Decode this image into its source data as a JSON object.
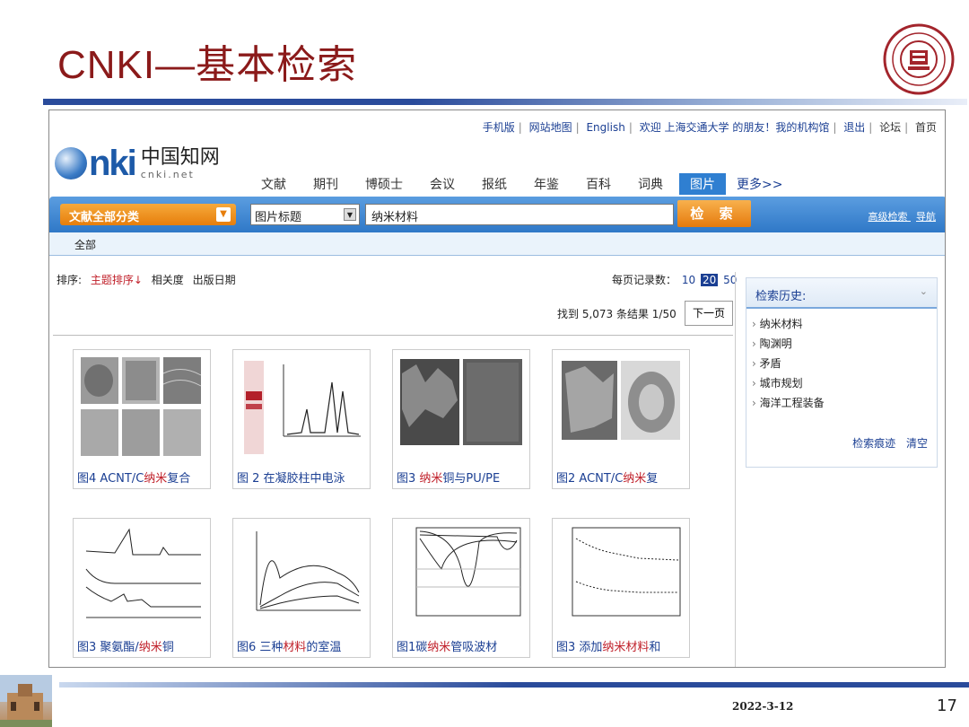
{
  "slide": {
    "title": "CNKI—基本检索",
    "date": "2022-3-12",
    "page_number": "17"
  },
  "toplinks": {
    "mobile": "手机版",
    "sitemap": "网站地图",
    "english": "English",
    "welcome": "欢迎 上海交通大学 的朋友！我的机构馆",
    "logout": "退出",
    "forum": "论坛",
    "home": "首页"
  },
  "logo": {
    "cn": "中国知网",
    "net": "cnki.net"
  },
  "nav": {
    "tabs": [
      "文献",
      "期刊",
      "博硕士",
      "会议",
      "报纸",
      "年鉴",
      "百科",
      "词典",
      "图片"
    ],
    "active": "图片",
    "more": "更多>>"
  },
  "search": {
    "category": "文献全部分类",
    "field": "图片标题",
    "query": "纳米材料",
    "button": "检 索",
    "advanced": "高级检索",
    "nav": "导航",
    "scope": "全部"
  },
  "sort": {
    "label": "排序:",
    "topic": "主题排序↓",
    "relevance": "相关度",
    "date": "出版日期"
  },
  "perpage": {
    "label": "每页记录数：",
    "options": [
      "10",
      "20",
      "50"
    ],
    "selected": "20"
  },
  "results": {
    "found": "找到 5,073 条结果  1/50",
    "next": "下一页"
  },
  "history": {
    "title": "检索历史:",
    "items": [
      "纳米材料",
      "陶渊明",
      "矛盾",
      "城市规划",
      "海洋工程装备"
    ],
    "trace": "检索痕迹",
    "clear": "清空"
  },
  "cards": [
    {
      "pre": "图4 ACNT/C",
      "hl": "纳米",
      "post": "复合"
    },
    {
      "pre": "图 2 在凝胶柱中电泳",
      "hl": "",
      "post": ""
    },
    {
      "pre": "图3  ",
      "hl": "纳米",
      "post": "铜与PU/PE"
    },
    {
      "pre": "图2  ACNT/C",
      "hl": "纳米",
      "post": "复"
    },
    {
      "pre": "图3  聚氨酯/",
      "hl": "纳米",
      "post": "铜"
    },
    {
      "pre": "图6  三种",
      "hl": "材料",
      "post": "的室温"
    },
    {
      "pre": "图1碳",
      "hl": "纳米",
      "post": "管吸波材"
    },
    {
      "pre": "图3  添加",
      "hl": "纳米材料",
      "post": "和"
    }
  ],
  "colors": {
    "title": "#8b1a1a",
    "link": "#1b3f93",
    "highlight": "#c0202a",
    "accent": "#e67e0c",
    "band": "#2f78c7"
  }
}
